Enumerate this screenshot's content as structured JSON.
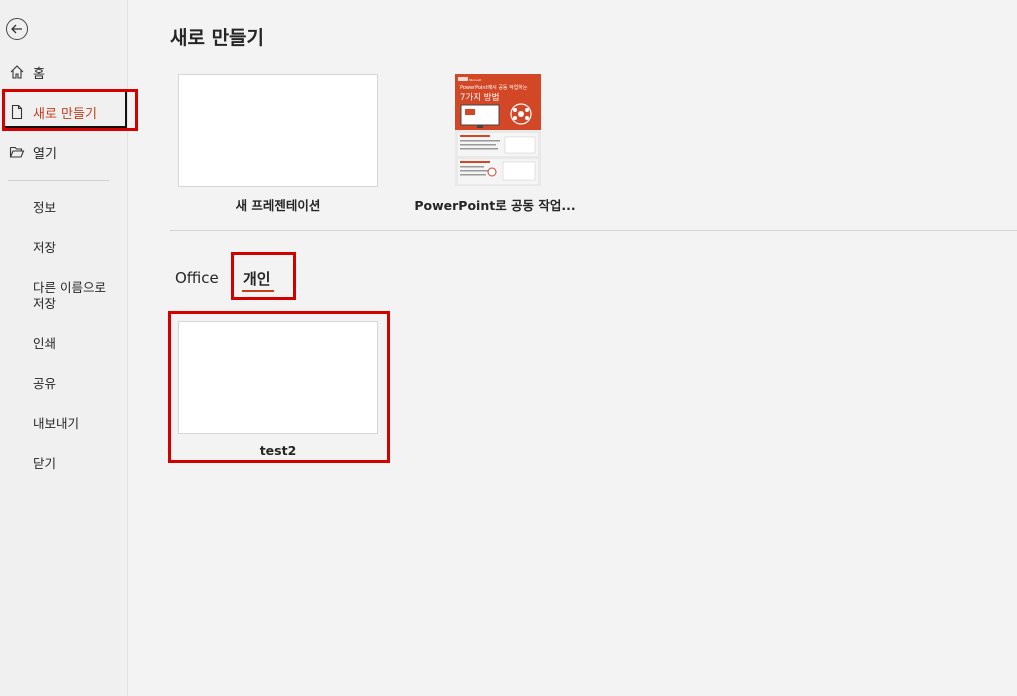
{
  "sidebar": {
    "home_label": "홈",
    "new_label": "새로 만들기",
    "open_label": "열기",
    "info_label": "정보",
    "save_label": "저장",
    "save_as_label_line1": "다른 이름으로",
    "save_as_label_line2": "저장",
    "print_label": "인쇄",
    "share_label": "공유",
    "export_label": "내보내기",
    "close_label": "닫기"
  },
  "main": {
    "title": "새로 만들기",
    "featured": [
      {
        "caption": "새 프레젠테이션"
      },
      {
        "caption": "PowerPoint로 공동 작업..."
      }
    ],
    "poster": {
      "brand": "Microsoft",
      "line1": "PowerPoint에서 공동 작업하는",
      "line2": "7가지 방법"
    },
    "tabs": [
      {
        "label": "Office"
      },
      {
        "label": "개인",
        "active": true
      }
    ],
    "personal_templates": [
      {
        "caption": "test2"
      }
    ]
  },
  "colors": {
    "accent": "#c43e1c",
    "highlight": "#d30000",
    "poster_orange": "#d24726"
  }
}
